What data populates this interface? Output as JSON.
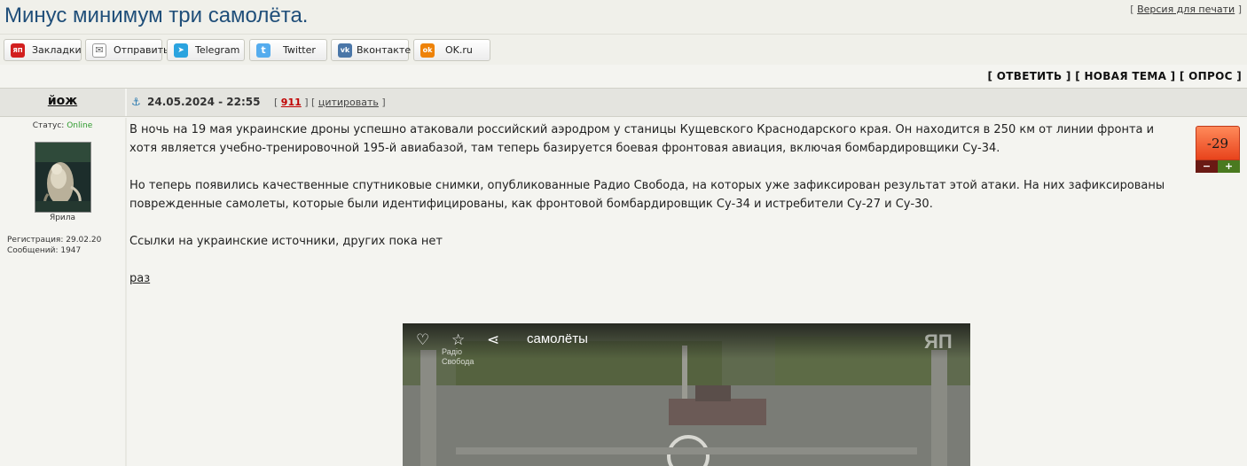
{
  "header": {
    "title": "Минус минимум три самолёта.",
    "print_prefix": "[",
    "print_link": "Версия для печати",
    "print_suffix": "]"
  },
  "share": [
    {
      "label": "Закладки",
      "icon": "yap-icon",
      "color": "#d21f1f",
      "glyph": "ЯП"
    },
    {
      "label": "Отправить",
      "icon": "mail-icon",
      "color": "#ffffff",
      "glyph": "✉"
    },
    {
      "label": "Telegram",
      "icon": "telegram-icon",
      "color": "#2aa3df",
      "glyph": "➤"
    },
    {
      "label": "Twitter",
      "icon": "twitter-icon",
      "color": "#55acee",
      "glyph": "t"
    },
    {
      "label": "Вконтакте",
      "icon": "vk-icon",
      "color": "#4a76a8",
      "glyph": "vk"
    },
    {
      "label": "OK.ru",
      "icon": "ok-icon",
      "color": "#ee8208",
      "glyph": "ok"
    }
  ],
  "actions": {
    "reply": "[ ОТВЕТИТЬ ]",
    "new_topic": "[ НОВАЯ ТЕМА ]",
    "poll": "[ ОПРОС ]"
  },
  "post": {
    "author": "йож",
    "date": "24.05.2024 - 22:55",
    "number": "911",
    "quote": "цитировать",
    "status_label": "Статус:",
    "status_value": "Online",
    "avatar_caption": "Ярила",
    "registration": "Регистрация: 29.02.20",
    "messages": "Сообщений: 1947",
    "rating": "-29",
    "rating_minus": "−",
    "rating_plus": "+",
    "paragraphs": [
      "В ночь на 19 мая украинские дроны успешно атаковали российский аэродром у станицы Кущевского Краснодарского края. Он находится в 250 км от линии фронта и хотя является учебно-тренировочной 195-й авиабазой, там теперь базируется боевая фронтовая авиация, включая бомбардировщики Су-34.",
      "Но теперь появились качественные спутниковые снимки, опубликованные Радио Свобода, на которых уже зафиксирован результат этой атаки. На них зафиксированы поврежденные самолеты, которые были идентифицированы, как фронтовой бомбардировщик Су-34 и истребители Су-27 и Су-30.",
      "Ссылки на украинские источники, других пока нет"
    ],
    "link_text": "раз"
  },
  "image": {
    "title": "самолёты",
    "watermark": "ЯП",
    "source_line1": "Радіо",
    "source_line2": "Свобода"
  },
  "colors": {
    "title": "#1f4e79",
    "online": "#2d9a2d",
    "rating": "#e8431c"
  }
}
